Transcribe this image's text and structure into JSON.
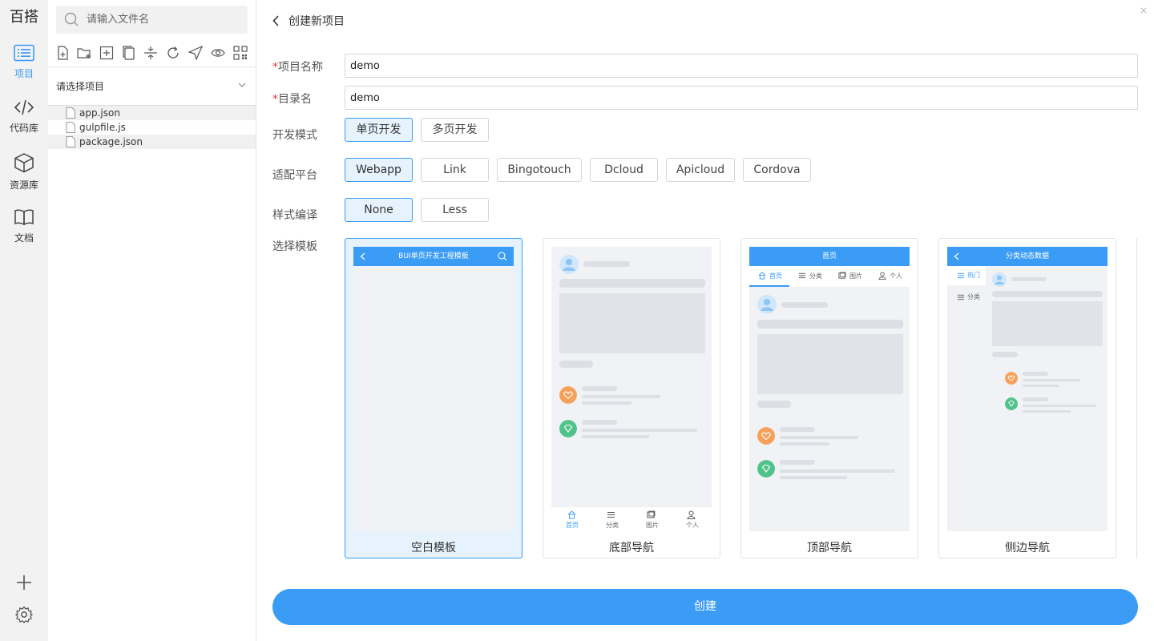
{
  "brand": "百搭",
  "rail": {
    "items": [
      {
        "label": "项目",
        "icon": "list-icon"
      },
      {
        "label": "代码库",
        "icon": "code-icon"
      },
      {
        "label": "资源库",
        "icon": "cube-icon"
      },
      {
        "label": "文档",
        "icon": "book-icon"
      }
    ],
    "bottom": [
      "plus-icon",
      "gear-icon"
    ]
  },
  "files": {
    "search_placeholder": "请输入文件名",
    "project_select": "请选择项目",
    "tree": [
      "app.json",
      "gulpfile.js",
      "package.json"
    ]
  },
  "main": {
    "back_title": "创建新项目",
    "fields": {
      "project_name_label": "项目名称",
      "project_name_value": "demo",
      "dir_label": "目录名",
      "dir_value": "demo",
      "dev_mode_label": "开发模式",
      "platform_label": "适配平台",
      "style_label": "样式编译",
      "template_label": "选择模板"
    },
    "dev_modes": [
      "单页开发",
      "多页开发"
    ],
    "platforms": [
      "Webapp",
      "Link",
      "Bingotouch",
      "Dcloud",
      "Apicloud",
      "Cordova"
    ],
    "styles": [
      "None",
      "Less"
    ],
    "templates": [
      {
        "caption": "空白模板",
        "header": "BUI单页开发工程模板"
      },
      {
        "caption": "底部导航",
        "tabs": [
          "首页",
          "分类",
          "图片",
          "个人"
        ]
      },
      {
        "caption": "顶部导航",
        "header": "首页",
        "tabs": [
          "首页",
          "分类",
          "图片",
          "个人"
        ]
      },
      {
        "caption": "侧边导航",
        "header": "分类动态数据",
        "side": [
          "热门",
          "分类"
        ]
      }
    ],
    "create_label": "创建",
    "close": "×"
  },
  "colors": {
    "accent": "#3a9cf5",
    "selected_bg": "#e6f3ff",
    "required": "#e33333",
    "orange": "#f7a05a",
    "green": "#4fc38a"
  }
}
